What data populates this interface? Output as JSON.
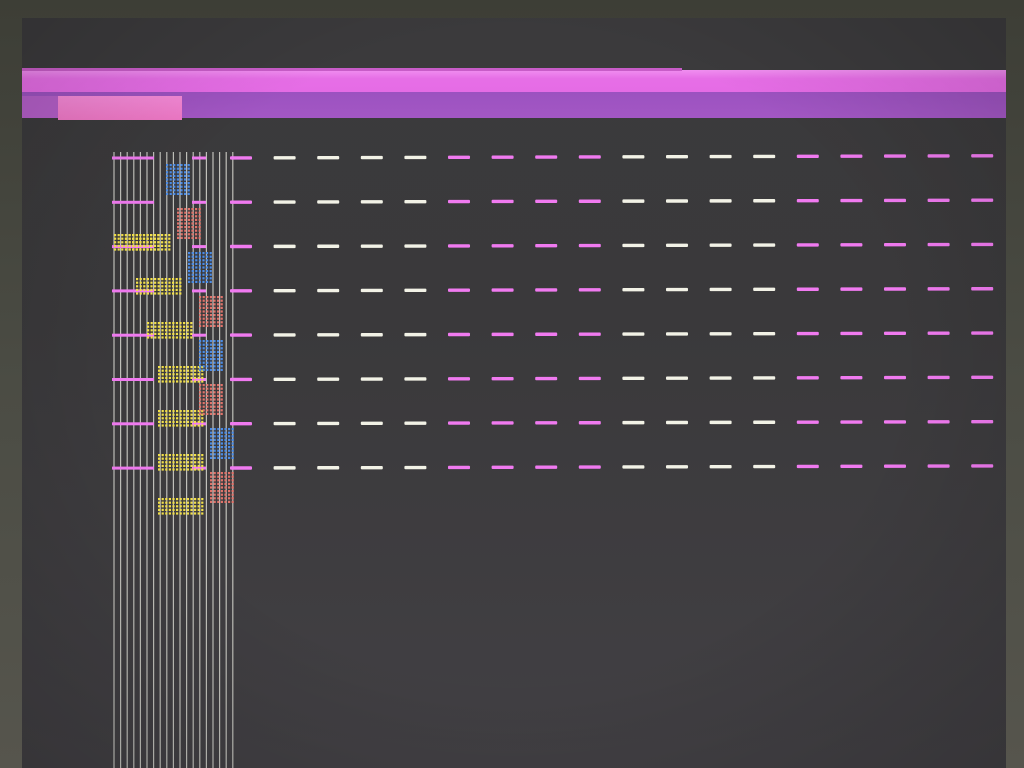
{
  "display": {
    "state": "corrupted-graphics",
    "palette": {
      "background": "#3b3a3c",
      "bezel": "#4a4a42",
      "title_bar": "#e66ee6",
      "title_bar_highlight": "#f087ee",
      "menu_bar": "#a04fbf",
      "menu_highlight": "#f07ac8",
      "dash_pink": "#f07af0",
      "dash_white": "#f2f2e6",
      "vertical_lines": "#d8d8d0",
      "block_blue": "#4a8be6",
      "block_red": "#e0736a",
      "block_yellow": "#f2e04a"
    }
  },
  "title_bar": {
    "label": ""
  },
  "menu_bar": {
    "highlighted_item": ""
  },
  "dash_grid": {
    "rows": 8,
    "columns": 18,
    "pattern": [
      "pink",
      "white",
      "white",
      "white",
      "white",
      "pink",
      "pink",
      "pink",
      "pink",
      "white",
      "white",
      "white",
      "white",
      "pink",
      "pink",
      "pink",
      "pink",
      "pink"
    ]
  },
  "stripe_column": {
    "line_count": 19
  },
  "glitch_blocks": [
    {
      "color": "blue",
      "row": 0,
      "col": 2
    },
    {
      "color": "yellow",
      "row": 1,
      "col": 0
    },
    {
      "color": "yellow",
      "row": 1,
      "col": 1
    },
    {
      "color": "red",
      "row": 1,
      "col": 3
    },
    {
      "color": "yellow",
      "row": 2,
      "col": 2
    },
    {
      "color": "blue",
      "row": 2,
      "col": 4
    },
    {
      "color": "yellow",
      "row": 3,
      "col": 3
    },
    {
      "color": "red",
      "row": 3,
      "col": 5
    },
    {
      "color": "yellow",
      "row": 4,
      "col": 4
    },
    {
      "color": "blue",
      "row": 4,
      "col": 5
    },
    {
      "color": "yellow",
      "row": 5,
      "col": 4
    },
    {
      "color": "red",
      "row": 5,
      "col": 5
    },
    {
      "color": "yellow",
      "row": 6,
      "col": 4
    },
    {
      "color": "blue",
      "row": 6,
      "col": 6
    },
    {
      "color": "yellow",
      "row": 7,
      "col": 4
    },
    {
      "color": "red",
      "row": 7,
      "col": 6
    }
  ]
}
